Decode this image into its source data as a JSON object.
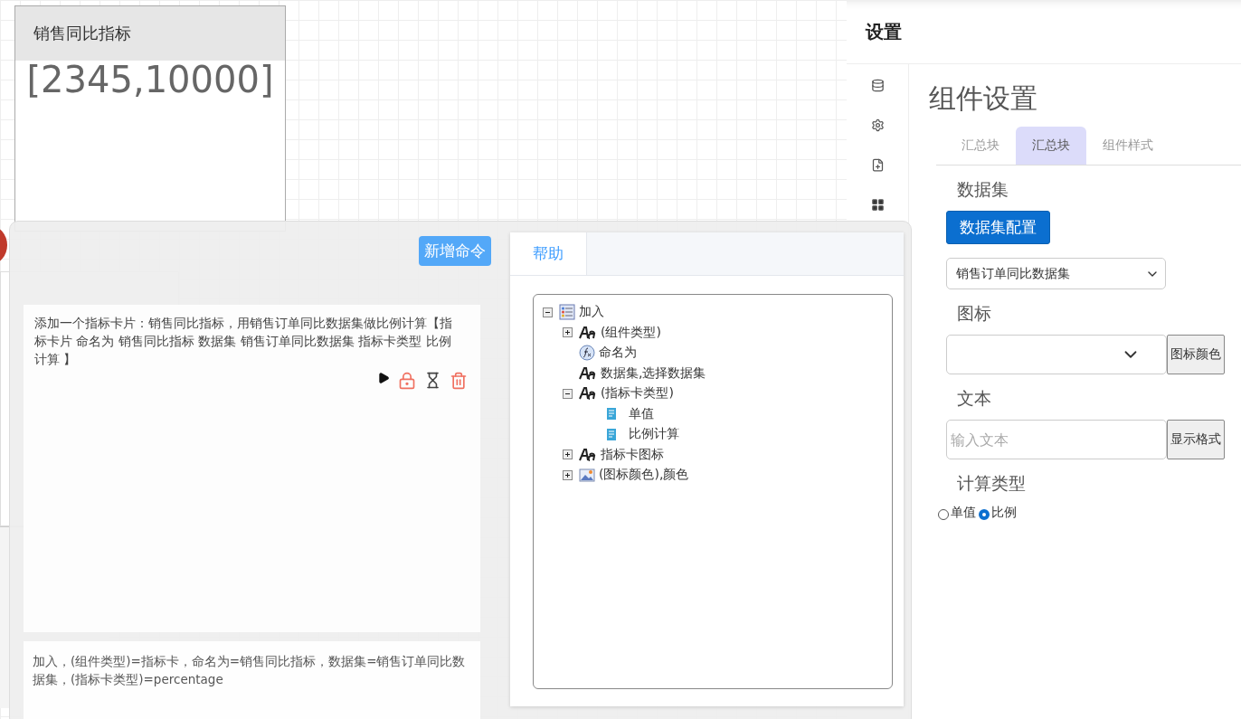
{
  "canvas": {
    "indicator_card": {
      "title": "销售同比指标",
      "value": "[2345,10000]"
    }
  },
  "command_dialog": {
    "add_button": "新增命令",
    "command": {
      "text": "添加一个指标卡片：销售同比指标，用销售订单同比数据集做比例计算【指标卡片 命名为 销售同比指标 数据集 销售订单同比数据集 指标卡类型 比例计算 】"
    },
    "result": {
      "text": "加入，(组件类型)=指标卡，命名为=销售同比指标，数据集=销售订单同比数据集，(指标卡类型)=percentage"
    },
    "help": {
      "tabs": [
        {
          "label": "帮助",
          "selected": true
        }
      ],
      "tree": [
        {
          "label": "加入",
          "kind": "list",
          "expanded": true,
          "children": [
            {
              "label": "(组件类型)",
              "kind": "font",
              "expanded": false
            },
            {
              "label": "命名为",
              "kind": "function"
            },
            {
              "label": "数据集,选择数据集",
              "kind": "font"
            },
            {
              "label": "(指标卡类型)",
              "kind": "font",
              "expanded": true,
              "children": [
                {
                  "label": "单值",
                  "kind": "doc"
                },
                {
                  "label": "比例计算",
                  "kind": "doc"
                }
              ]
            },
            {
              "label": "指标卡图标",
              "kind": "font",
              "expanded": false
            },
            {
              "label": "(图标颜色),颜色",
              "kind": "image",
              "expanded": false
            }
          ]
        }
      ]
    }
  },
  "settings": {
    "header": "设置",
    "title": "组件设置",
    "tabs": [
      {
        "label": "汇总块",
        "selected": false
      },
      {
        "label": "汇总块",
        "selected": true
      },
      {
        "label": "组件样式",
        "selected": false
      }
    ],
    "dataset": {
      "label": "数据集",
      "button": "数据集配置",
      "value": "销售订单同比数据集"
    },
    "icon": {
      "label": "图标",
      "button": "图标颜色"
    },
    "text": {
      "label": "文本",
      "placeholder": "输入文本",
      "button": "显示格式"
    },
    "calc_type": {
      "label": "计算类型",
      "options": [
        {
          "label": "单值",
          "selected": false
        },
        {
          "label": "比例",
          "selected": true
        }
      ]
    }
  }
}
